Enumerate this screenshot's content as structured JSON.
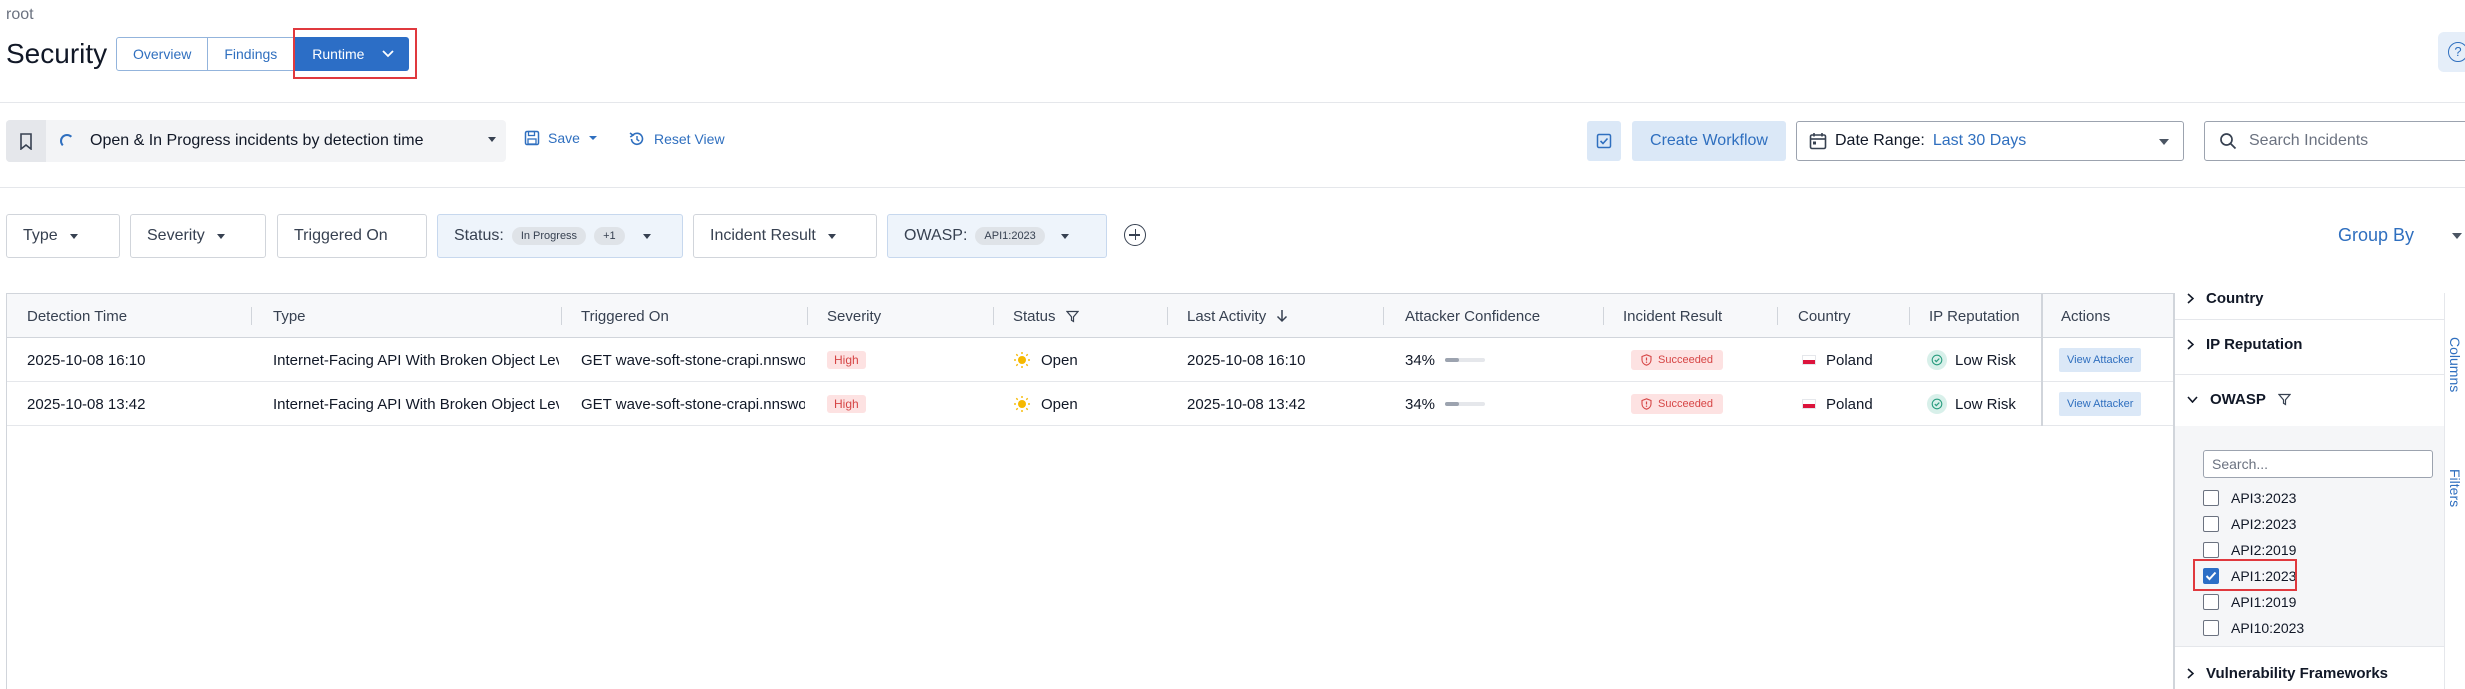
{
  "header": {
    "breadcrumb": "root",
    "title": "Security",
    "tabs": [
      {
        "label": "Overview",
        "active": false
      },
      {
        "label": "Findings",
        "active": false
      },
      {
        "label": "Runtime",
        "active": true
      }
    ],
    "help_icon": "question-circle-icon"
  },
  "toolbar": {
    "view_name": "Open & In Progress incidents by detection time",
    "save_label": "Save",
    "reset_label": "Reset View",
    "create_workflow_label": "Create Workflow",
    "date_range_label": "Date Range:",
    "date_range_value": "Last 30 Days",
    "search_placeholder": "Search Incidents"
  },
  "filters": {
    "type": "Type",
    "severity": "Severity",
    "triggered_on": "Triggered On",
    "status_label": "Status:",
    "status_chip": "In Progress",
    "status_extra": "+1",
    "incident_result": "Incident Result",
    "owasp_label": "OWASP:",
    "owasp_chip": "API1:2023",
    "group_by": "Group By"
  },
  "table": {
    "columns": [
      "Detection Time",
      "Type",
      "Triggered On",
      "Severity",
      "Status",
      "Last Activity",
      "Attacker Confidence",
      "Incident Result",
      "Country",
      "IP Reputation",
      "Actions"
    ],
    "rows": [
      {
        "detection_time": "2025-10-08 16:10",
        "type": "Internet-Facing API With Broken Object Lev",
        "triggered_on": "GET wave-soft-stone-crapi.nnswo",
        "severity": "High",
        "status": "Open",
        "last_activity": "2025-10-08 16:10",
        "confidence": "34%",
        "confidence_value": 0.34,
        "result": "Succeeded",
        "country": "Poland",
        "ip_reputation": "Low Risk",
        "action": "View Attacker"
      },
      {
        "detection_time": "2025-10-08 13:42",
        "type": "Internet-Facing API With Broken Object Lev",
        "triggered_on": "GET wave-soft-stone-crapi.nnswo",
        "severity": "High",
        "status": "Open",
        "last_activity": "2025-10-08 13:42",
        "confidence": "34%",
        "confidence_value": 0.34,
        "result": "Succeeded",
        "country": "Poland",
        "ip_reputation": "Low Risk",
        "action": "View Attacker"
      }
    ]
  },
  "side_panel": {
    "country": "Country",
    "ip_reputation": "IP Reputation",
    "owasp": "OWASP",
    "search_placeholder": "Search...",
    "options": [
      {
        "label": "API3:2023",
        "checked": false
      },
      {
        "label": "API2:2023",
        "checked": false
      },
      {
        "label": "API2:2019",
        "checked": false
      },
      {
        "label": "API1:2023",
        "checked": true
      },
      {
        "label": "API1:2019",
        "checked": false
      },
      {
        "label": "API10:2023",
        "checked": false
      }
    ],
    "vulnerability_frameworks": "Vulnerability Frameworks"
  },
  "tool_strip": {
    "columns": "Columns",
    "filters": "Filters"
  },
  "colors": {
    "accent": "#2c6ec6",
    "link": "#2f6fbf",
    "danger": "#d64545",
    "highlight": "#e0393e"
  }
}
